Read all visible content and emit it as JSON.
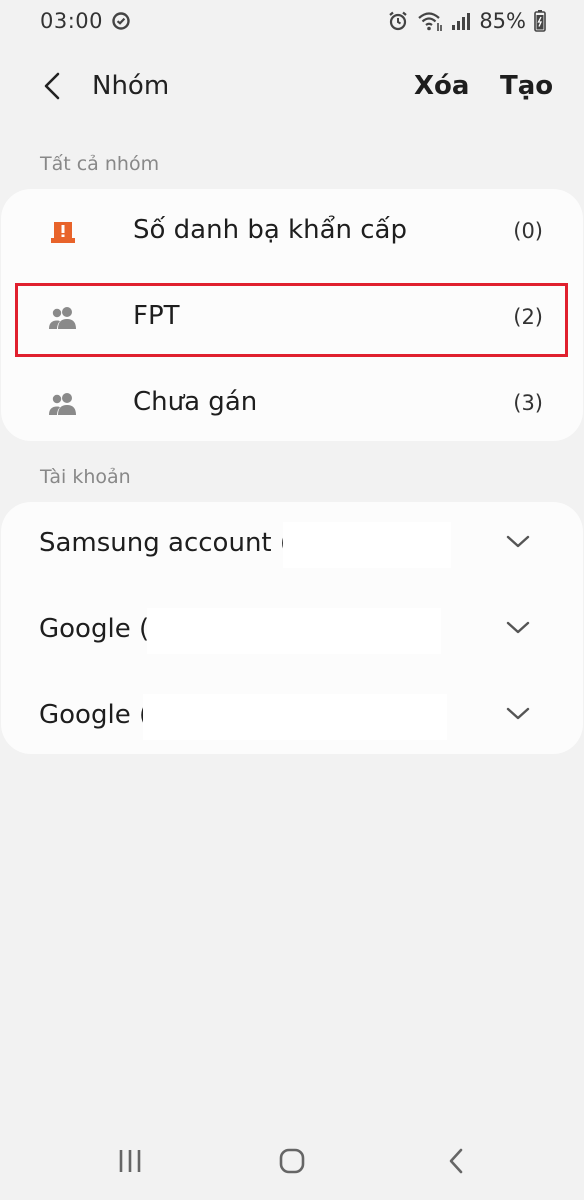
{
  "status_bar": {
    "time": "03:00",
    "battery": "85%",
    "icons": [
      "sync-icon",
      "alarm-icon",
      "wifi-icon",
      "signal-icon",
      "battery-icon"
    ]
  },
  "app_bar": {
    "title": "Nhóm",
    "delete_label": "Xóa",
    "create_label": "Tạo"
  },
  "groups_section": {
    "label": "Tất cả nhóm",
    "items": [
      {
        "name": "Số danh bạ khẩn cấp",
        "count": "(0)",
        "icon": "emergency-icon",
        "icon_color": "#e8632a"
      },
      {
        "name": "FPT",
        "count": "(2)",
        "icon": "people-icon",
        "highlighted": true
      },
      {
        "name": "Chưa gán",
        "count": "(3)",
        "icon": "people-icon"
      }
    ]
  },
  "accounts_section": {
    "label": "Tài khoản",
    "items": [
      {
        "name": "Samsung account ("
      },
      {
        "name": "Google ("
      },
      {
        "name": "Google ("
      }
    ]
  },
  "colors": {
    "background": "#f2f2f2",
    "card": "#fcfcfc",
    "highlight_border": "#e0202e",
    "emergency_icon": "#e8632a"
  },
  "nav_bar": {
    "icons": [
      "recent-apps-icon",
      "home-icon",
      "back-nav-icon"
    ]
  }
}
